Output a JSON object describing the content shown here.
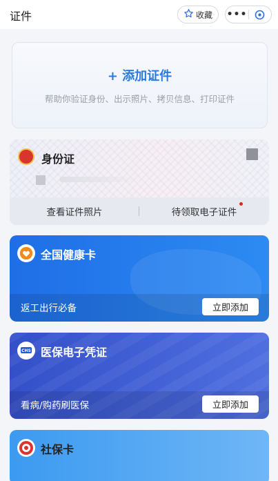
{
  "header": {
    "title": "证件",
    "favorite_label": "收藏",
    "more_glyph": "•••"
  },
  "add_card": {
    "title": "+ 添加证件",
    "subtitle": "帮助你验证身份、出示照片、拷贝信息、打印证件"
  },
  "id_card": {
    "name": "身份证",
    "view_photo_label": "查看证件照片",
    "claim_label": "待领取电子证件"
  },
  "health_card": {
    "name": "全国健康卡",
    "description": "返工出行必备",
    "button_label": "立即添加",
    "color": "#1f6ee6"
  },
  "insurance_card": {
    "name": "医保电子凭证",
    "badge_text": "CHS",
    "description": "看病/购药刷医保",
    "button_label": "立即添加",
    "color": "#3450c9"
  },
  "social_card": {
    "name": "社保卡",
    "color": "#3c9af0"
  },
  "colors": {
    "accent": "#2a7be0",
    "notification_dot": "#e0251b"
  }
}
